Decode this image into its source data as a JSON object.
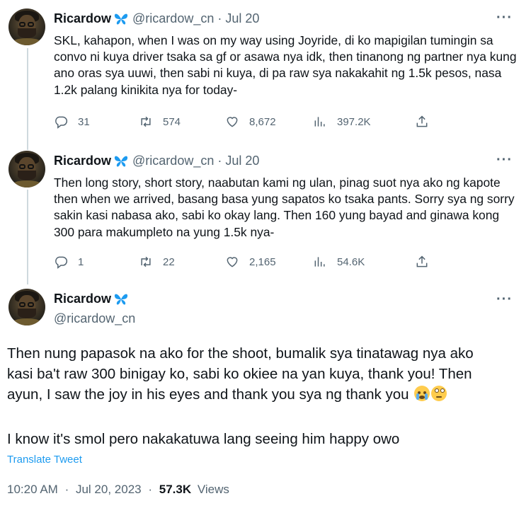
{
  "author": {
    "name": "Ricardow",
    "handle": "@ricardow_cn"
  },
  "tweets": [
    {
      "date": "Jul 20",
      "text": "SKL, kahapon, when I was on my way using Joyride, di ko mapigilan tumingin sa convo ni kuya driver tsaka sa gf or asawa nya idk, then tinanong ng partner nya kung ano oras sya uuwi, then sabi ni kuya, di pa raw sya nakakahit ng 1.5k pesos, nasa 1.2k palang kinikita nya for today-",
      "replies": "31",
      "retweets": "574",
      "likes": "8,672",
      "views": "397.2K"
    },
    {
      "date": "Jul 20",
      "text": "Then long story, short story, naabutan kami ng ulan, pinag suot nya ako ng kapote then when we arrived, basang basa yung sapatos ko tsaka pants. Sorry sya ng sorry sakin kasi nabasa ako, sabi ko okay lang. Then 160 yung bayad and ginawa kong 300 para makumpleto na yung 1.5k nya-",
      "replies": "1",
      "retweets": "22",
      "likes": "2,165",
      "views": "54.6K"
    }
  ],
  "main_tweet": {
    "paragraph1": "Then nung papasok na ako for the shoot, bumalik sya tinatawag nya ako kasi ba't raw 300 binigay ko, sabi ko okiee na yan kuya, thank you! Then ayun, I saw the joy in his eyes and thank you sya ng thank you",
    "emoji1": "loudly-crying-face",
    "emoji2": "face-holding-back-tears",
    "paragraph2": "I know it's smol pero nakakatuwa lang seeing him happy owo",
    "translate_label": "Translate Tweet",
    "time": "10:20 AM",
    "full_date": "Jul 20, 2023",
    "views_count": "57.3K",
    "views_label": "Views"
  },
  "separator": "·",
  "more_label": "···",
  "icons": [
    "butterfly-icon",
    "reply-icon",
    "retweet-icon",
    "like-icon",
    "views-icon",
    "share-icon",
    "more-icon"
  ],
  "colors": {
    "text": "#0f1419",
    "secondary": "#536471",
    "link": "#1d9bf0",
    "butterfly": "#1d9bf0",
    "thread_line": "#cfd9de"
  }
}
